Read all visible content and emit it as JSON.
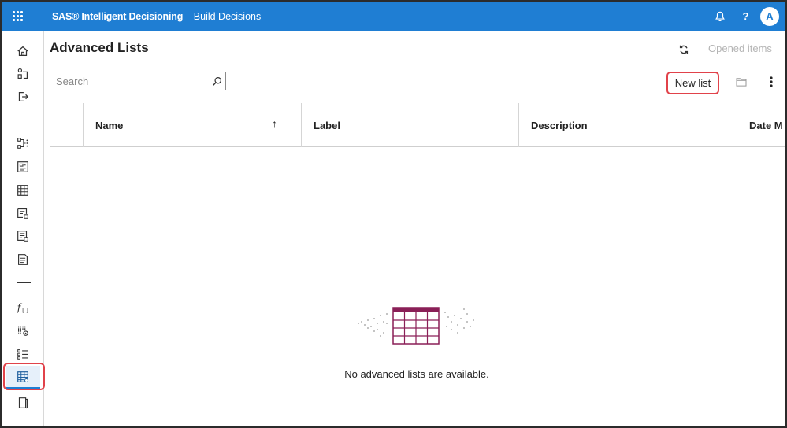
{
  "topbar": {
    "app_name": "SAS® Intelligent Decisioning",
    "section": "- Build Decisions",
    "help_label": "?",
    "avatar_initial": "A"
  },
  "siderail": {
    "items": [
      {
        "name": "home-icon"
      },
      {
        "name": "manage-models-icon"
      },
      {
        "name": "sign-out-icon"
      },
      {
        "name": "decisions-icon"
      },
      {
        "name": "rule-sets-icon"
      },
      {
        "name": "lookup-tables-icon"
      },
      {
        "name": "data-grid-icon"
      },
      {
        "name": "code-files-icon"
      },
      {
        "name": "treatments-icon"
      },
      {
        "name": "custom-functions-icon"
      },
      {
        "name": "global-variables-icon"
      },
      {
        "name": "numbered-list-icon"
      },
      {
        "name": "advanced-lists-icon",
        "active": true
      },
      {
        "name": "documents-icon"
      }
    ]
  },
  "page": {
    "title": "Advanced Lists",
    "opened_items": "Opened items"
  },
  "search": {
    "placeholder": "Search",
    "value": ""
  },
  "toolbar": {
    "new_list_label": "New list"
  },
  "table": {
    "columns": [
      "Name",
      "Label",
      "Description",
      "Date M"
    ],
    "sort_indicator": "↑"
  },
  "empty_state": {
    "message": "No advanced lists are available."
  },
  "colors": {
    "brand_blue": "#1f7ed3",
    "highlight_red": "#e1424a",
    "illustration": "#8a1f57"
  }
}
